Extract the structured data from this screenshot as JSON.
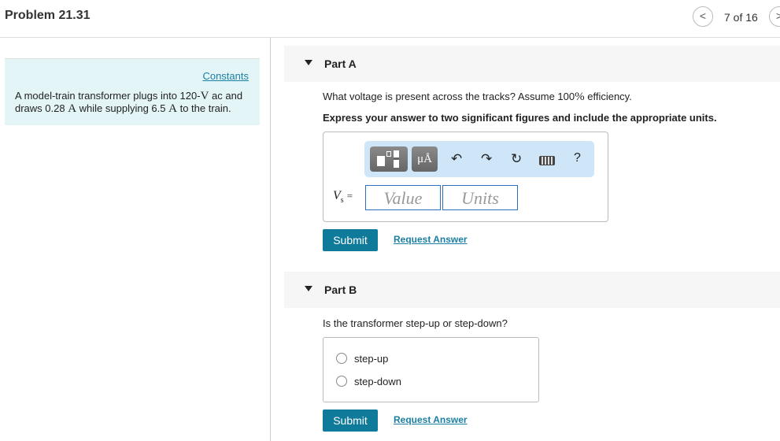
{
  "header": {
    "title": "Problem 21.31",
    "page_indicator": "7 of 16",
    "prev": "<",
    "next": ">"
  },
  "problem": {
    "constants_link": "Constants",
    "text_1": "A model-train transformer plugs into 120-",
    "unit_v": "V",
    "text_2": " ac and draws 0.28 ",
    "unit_a": "A",
    "text_3": " while supplying 6.5 ",
    "text_4": " to the train."
  },
  "partA": {
    "label": "Part A",
    "question_1": "What voltage is present across the tracks? Assume 100",
    "percent": "%",
    "question_2": " efficiency.",
    "instruction": "Express your answer to two significant figures and include the appropriate units.",
    "var_label": "V",
    "var_sub": "s",
    "equals": "=",
    "value_placeholder": "Value",
    "units_placeholder": "Units",
    "units_button": "μÅ",
    "help": "?",
    "submit": "Submit",
    "request": "Request Answer"
  },
  "partB": {
    "label": "Part B",
    "question": "Is the transformer step-up or step-down?",
    "options": [
      "step-up",
      "step-down"
    ],
    "submit": "Submit",
    "request": "Request Answer"
  }
}
